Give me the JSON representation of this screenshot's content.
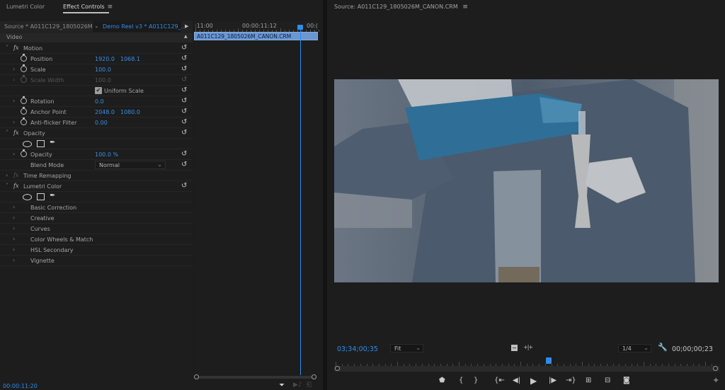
{
  "left_panel": {
    "tabs": [
      {
        "label": "Lumetri Color",
        "active": false
      },
      {
        "label": "Effect Controls",
        "active": true
      }
    ],
    "tab_menu_icon": "hamburger-menu-icon",
    "source_label": "Source * A011C129_1805026M...",
    "sequence_label": "Demo Reel v3 * A011C129_...",
    "section_label": "Video",
    "effects": {
      "motion": {
        "name": "Motion",
        "properties": {
          "position": {
            "label": "Position",
            "x": "1920.0",
            "y": "1068.1"
          },
          "scale": {
            "label": "Scale",
            "value": "100.0"
          },
          "scale_width": {
            "label": "Scale Width",
            "value": "100.0",
            "disabled": true
          },
          "uniform_scale": {
            "label": "Uniform Scale",
            "checked": true
          },
          "rotation": {
            "label": "Rotation",
            "value": "0.0"
          },
          "anchor_point": {
            "label": "Anchor Point",
            "x": "2048.0",
            "y": "1080.0"
          },
          "anti_flicker": {
            "label": "Anti-flicker Filter",
            "value": "0.00"
          }
        }
      },
      "opacity": {
        "name": "Opacity",
        "properties": {
          "opacity": {
            "label": "Opacity",
            "value": "100.0 %"
          },
          "blend_mode": {
            "label": "Blend Mode",
            "value": "Normal"
          }
        }
      },
      "time_remapping": {
        "name": "Time Remapping",
        "disabled": true
      },
      "lumetri": {
        "name": "Lumetri Color",
        "sections": [
          "Basic Correction",
          "Creative",
          "Curves",
          "Color Wheels & Match",
          "HSL Secondary",
          "Vignette"
        ]
      }
    },
    "timeline": {
      "ruler_labels": [
        ":11:00",
        "00:00:11:12",
        "00:("
      ],
      "clip_name": "A011C129_1805026M_CANON.CRM"
    },
    "current_timecode": "00:00:11:20"
  },
  "right_panel": {
    "title": "Source: A011C129_1805026M_CANON.CRM",
    "current_timecode": "03;34;00;35",
    "zoom_select": "Fit",
    "resolution_select": "1/4",
    "duration_timecode": "00;00;00;23",
    "transport_buttons": [
      {
        "name": "add-marker-icon",
        "glyph": "⬟"
      },
      {
        "name": "mark-in-icon",
        "glyph": "{"
      },
      {
        "name": "mark-out-icon",
        "glyph": "}"
      },
      {
        "name": "go-to-in-icon",
        "glyph": "{⇤"
      },
      {
        "name": "step-back-icon",
        "glyph": "◀|"
      },
      {
        "name": "play-icon",
        "glyph": "▶"
      },
      {
        "name": "step-forward-icon",
        "glyph": "|▶"
      },
      {
        "name": "go-to-out-icon",
        "glyph": "⇥}"
      },
      {
        "name": "insert-icon",
        "glyph": "⊞"
      },
      {
        "name": "overwrite-icon",
        "glyph": "⊟"
      },
      {
        "name": "export-frame-icon",
        "glyph": "◙"
      },
      {
        "name": "button-editor-icon",
        "glyph": "+"
      }
    ]
  },
  "colors": {
    "accent": "#2d8ceb",
    "panel_bg": "#1d1d1d",
    "clip": "#6a96d2"
  }
}
